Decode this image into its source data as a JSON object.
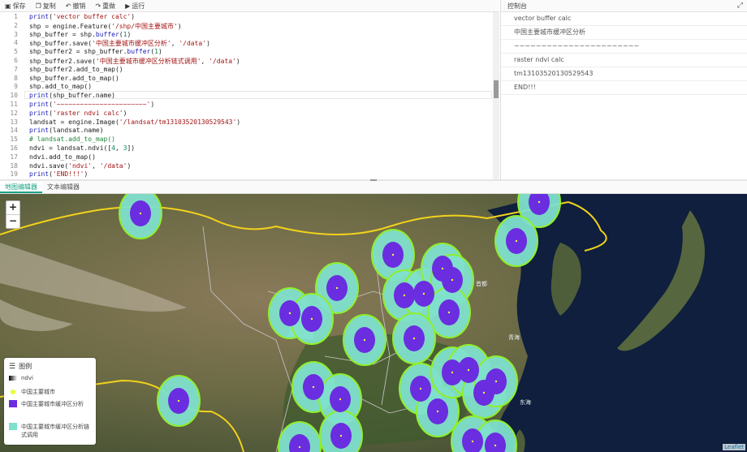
{
  "toolbar": {
    "save": "保存",
    "copy": "复制",
    "undo": "撤销",
    "redo": "重做",
    "run": "运行"
  },
  "console": {
    "title": "控制台",
    "lines": [
      "vector buffer calc",
      "中国主要城市缓冲区分析",
      "~~~~~~~~~~~~~~~~~~~~~~~",
      "raster ndvi calc",
      "tm13103520130529543",
      "END!!!"
    ]
  },
  "editor": {
    "line_numbers": [
      "1",
      "2",
      "3",
      "4",
      "5",
      "6",
      "7",
      "8",
      "9",
      "10",
      "11",
      "12",
      "13",
      "14",
      "15",
      "16",
      "17",
      "18",
      "19"
    ],
    "lines": [
      "print('vector buffer calc')",
      "shp = engine.Feature('/shp/中国主要城市')",
      "shp_buffer = shp.buffer(1)",
      "shp_buffer.save('中国主要城市缓冲区分析', '/data')",
      "shp_buffer2 = shp_buffer.buffer(1)",
      "shp_buffer2.save('中国主要城市缓冲区分析链式调用', '/data')",
      "shp_buffer2.add_to_map()",
      "shp_buffer.add_to_map()",
      "shp.add_to_map()",
      "print(shp_buffer.name)",
      "print('~~~~~~~~~~~~~~~~~~~~~~~')",
      "print('raster ndvi calc')",
      "landsat = engine.Image('/landsat/tm13103520130529543')",
      "print(landsat.name)",
      "# landsat.add_to_map()",
      "ndvi = landsat.ndvi([4, 3])",
      "ndvi.add_to_map()",
      "ndvi.save('ndvi', '/data')",
      "print('END!!!')"
    ]
  },
  "tabs": {
    "map_editor": "地图编辑器",
    "text_editor": "文本编辑器"
  },
  "map": {
    "zoom_in": "+",
    "zoom_out": "−",
    "attribution": "Leaflet",
    "labels": [
      "首都",
      "青海",
      "东海"
    ]
  },
  "legend": {
    "title": "图例",
    "items": [
      "ndvi",
      "中国主要城市",
      "中国主要城市缓冲区分析",
      "中国主要城市缓冲区分析链式调用"
    ]
  },
  "colors": {
    "buffer_outer": "#7fe0cc",
    "buffer_inner": "#6a2de0",
    "buffer_stroke": "#8fef2a",
    "city_point": "#e6ff3a",
    "accent": "#19a186"
  }
}
